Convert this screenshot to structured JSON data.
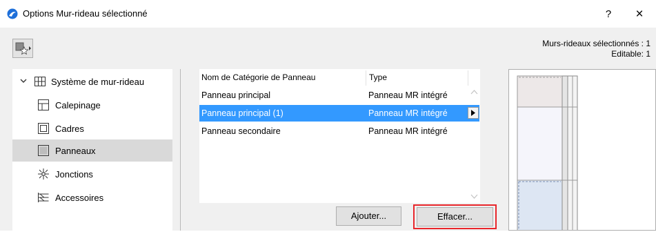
{
  "window": {
    "title": "Options Mur-rideau sélectionné",
    "help_label": "?",
    "close_label": "×"
  },
  "selection_info": {
    "line1": "Murs-rideaux sélectionnés : 1",
    "line2": "Editable: 1"
  },
  "tree": {
    "root": "Système de mur-rideau",
    "items": [
      {
        "label": "Calepinage",
        "icon": "scheme-icon"
      },
      {
        "label": "Cadres",
        "icon": "frame-icon"
      },
      {
        "label": "Panneaux",
        "icon": "panel-icon",
        "selected": true
      },
      {
        "label": "Jonctions",
        "icon": "junction-icon"
      },
      {
        "label": "Accessoires",
        "icon": "accessory-icon"
      }
    ]
  },
  "table": {
    "columns": [
      "Nom de Catégorie de Panneau",
      "Type"
    ],
    "rows": [
      {
        "name": "Panneau principal",
        "type": "Panneau MR intégré",
        "selected": false
      },
      {
        "name": "Panneau principal (1)",
        "type": "Panneau MR intégré",
        "selected": true
      },
      {
        "name": "Panneau secondaire",
        "type": "Panneau MR intégré",
        "selected": false
      }
    ]
  },
  "buttons": {
    "add": "Ajouter...",
    "delete": "Effacer..."
  },
  "colors": {
    "selection": "#3399ff",
    "highlight_border": "#e8262b",
    "app_icon": "#1e6fd9"
  }
}
